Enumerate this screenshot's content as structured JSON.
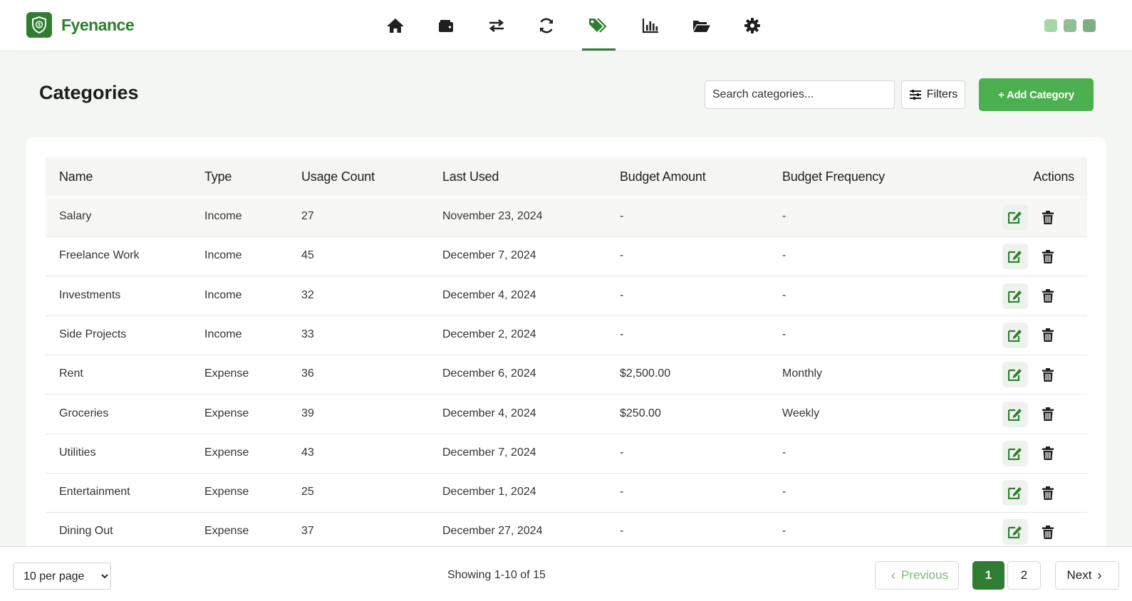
{
  "app": {
    "brand": "Fyenance"
  },
  "nav": {
    "icons": [
      "home-icon",
      "wallet-icon",
      "transfer-icon",
      "sync-icon",
      "tags-icon",
      "chart-icon",
      "folder-open-icon",
      "gear-icon"
    ],
    "active": "tags-icon"
  },
  "header": {
    "title": "Categories",
    "search_placeholder": "Search categories...",
    "filters_label": "Filters",
    "add_label": "+ Add Category"
  },
  "table": {
    "columns": [
      "Name",
      "Type",
      "Usage Count",
      "Last Used",
      "Budget Amount",
      "Budget Frequency",
      "Actions"
    ],
    "rows": [
      {
        "name": "Salary",
        "type": "Income",
        "usage": "27",
        "last_used": "November 23, 2024",
        "budget": "-",
        "freq": "-"
      },
      {
        "name": "Freelance Work",
        "type": "Income",
        "usage": "45",
        "last_used": "December 7, 2024",
        "budget": "-",
        "freq": "-"
      },
      {
        "name": "Investments",
        "type": "Income",
        "usage": "32",
        "last_used": "December 4, 2024",
        "budget": "-",
        "freq": "-"
      },
      {
        "name": "Side Projects",
        "type": "Income",
        "usage": "33",
        "last_used": "December 2, 2024",
        "budget": "-",
        "freq": "-"
      },
      {
        "name": "Rent",
        "type": "Expense",
        "usage": "36",
        "last_used": "December 6, 2024",
        "budget": "$2,500.00",
        "freq": "Monthly"
      },
      {
        "name": "Groceries",
        "type": "Expense",
        "usage": "39",
        "last_used": "December 4, 2024",
        "budget": "$250.00",
        "freq": "Weekly"
      },
      {
        "name": "Utilities",
        "type": "Expense",
        "usage": "43",
        "last_used": "December 7, 2024",
        "budget": "-",
        "freq": "-"
      },
      {
        "name": "Entertainment",
        "type": "Expense",
        "usage": "25",
        "last_used": "December 1, 2024",
        "budget": "-",
        "freq": "-"
      },
      {
        "name": "Dining Out",
        "type": "Expense",
        "usage": "37",
        "last_used": "December 27, 2024",
        "budget": "-",
        "freq": "-"
      }
    ]
  },
  "footer": {
    "per_page": "10 per page",
    "showing": "Showing 1-10 of 15",
    "previous": "Previous",
    "pages": [
      "1",
      "2"
    ],
    "next": "Next"
  },
  "colors": {
    "accent": "#2e7d32",
    "button": "#4caf50",
    "window_dots": [
      "#a5d6a7",
      "#8fbf92",
      "#7fae84"
    ]
  }
}
